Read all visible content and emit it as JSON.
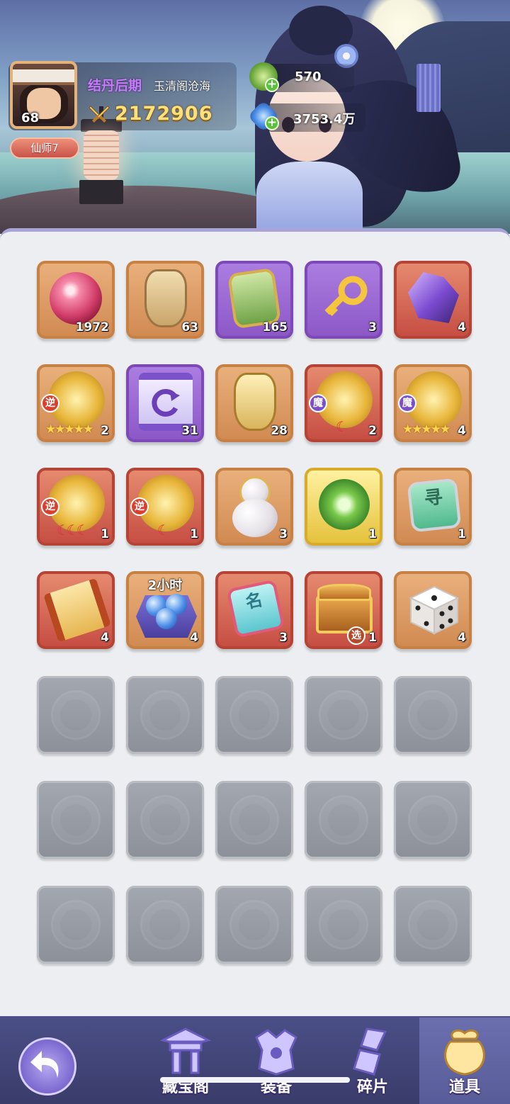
{
  "player": {
    "level": "68",
    "realm": "结丹后期",
    "guild": "玉清阁沧海",
    "power": "2172906",
    "title": "仙师7"
  },
  "currencies": [
    {
      "icon": "jade-coin-icon",
      "value": "570"
    },
    {
      "icon": "spirit-crystal-icon",
      "value": "3753.4万"
    }
  ],
  "inventory": {
    "rows": [
      [
        {
          "icon": "red-pearl-icon",
          "quality": "orange",
          "count": "1972"
        },
        {
          "icon": "explore-token-icon",
          "quality": "orange",
          "count": "63"
        },
        {
          "icon": "green-token-icon",
          "quality": "purple",
          "count": "165"
        },
        {
          "icon": "golden-key-icon",
          "quality": "purple",
          "count": "3"
        },
        {
          "icon": "crystal-ore-icon",
          "quality": "red",
          "count": "4"
        }
      ],
      [
        {
          "icon": "companion-orb-icon",
          "quality": "orange",
          "count": "2",
          "tag": "逆",
          "stars": "★★★★★"
        },
        {
          "icon": "scroll-reset-icon",
          "quality": "purple",
          "count": "31"
        },
        {
          "icon": "explore-token-gold-icon",
          "quality": "orange",
          "count": "28"
        },
        {
          "icon": "companion-orb-icon",
          "quality": "red",
          "count": "2",
          "tag": "魔",
          "moons": "☾"
        },
        {
          "icon": "companion-orb-icon",
          "quality": "orange",
          "count": "4",
          "tag": "魔",
          "stars": "★★★★★"
        }
      ],
      [
        {
          "icon": "companion-orb-icon",
          "quality": "red",
          "count": "1",
          "tag": "逆",
          "moons": "☾☾☾"
        },
        {
          "icon": "companion-orb-icon",
          "quality": "red",
          "count": "1",
          "tag": "逆",
          "moons": "☾"
        },
        {
          "icon": "gourd-icon",
          "quality": "orange",
          "count": "3"
        },
        {
          "icon": "leaf-emblem-icon",
          "quality": "gold",
          "count": "1"
        },
        {
          "icon": "seek-tag-icon",
          "quality": "orange",
          "count": "1",
          "glyph": "寻"
        }
      ],
      [
        {
          "icon": "scroll-icon",
          "quality": "red",
          "count": "4"
        },
        {
          "icon": "spirit-orbs-icon",
          "quality": "orange",
          "count": "4",
          "hours": "2小时"
        },
        {
          "icon": "name-card-icon",
          "quality": "red",
          "count": "3",
          "glyph": "名"
        },
        {
          "icon": "treasure-chest-icon",
          "quality": "red",
          "count": "1",
          "tag": "选"
        },
        {
          "icon": "dice-icon",
          "quality": "orange",
          "count": "4"
        }
      ]
    ],
    "empty_rows": 3
  },
  "nav": {
    "tabs": [
      {
        "label": "藏宝阁",
        "icon": "pavilion-icon"
      },
      {
        "label": "装备",
        "icon": "armor-icon"
      },
      {
        "label": "碎片",
        "icon": "shards-icon"
      },
      {
        "label": "道具",
        "icon": "bag-icon"
      }
    ],
    "active": "道具"
  },
  "colors": {
    "realm": "#c77cff",
    "power": "#ffe07a",
    "accent": "#a8a4d8"
  }
}
